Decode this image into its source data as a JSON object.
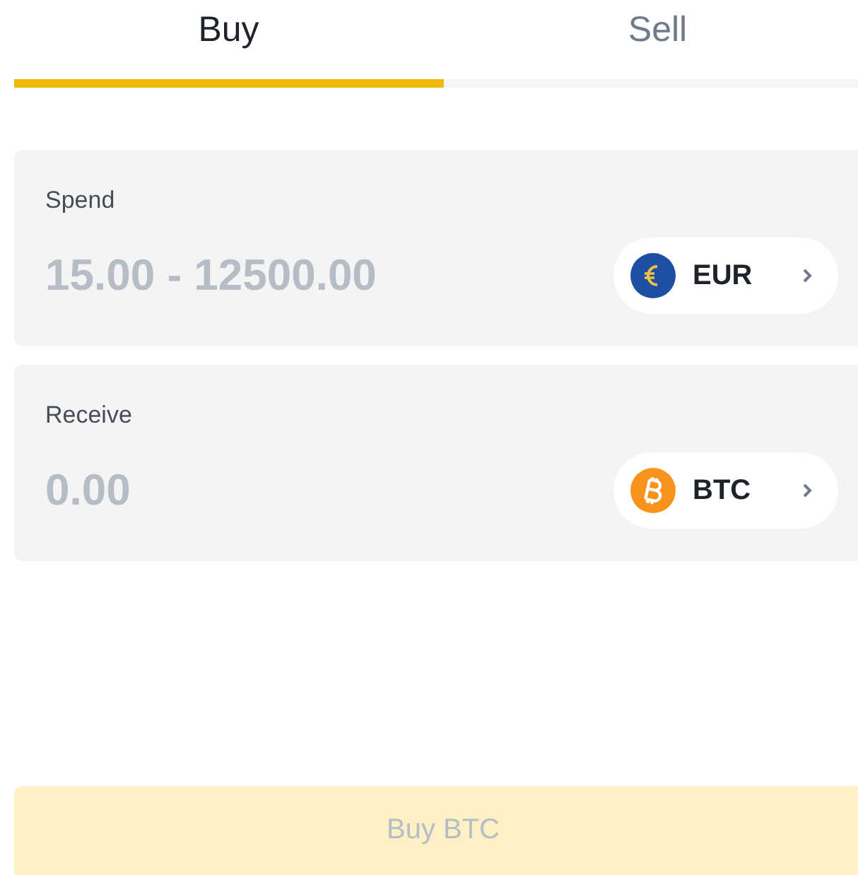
{
  "tabs": [
    {
      "label": "Buy",
      "selected": true
    },
    {
      "label": "Sell",
      "selected": false
    }
  ],
  "fields": [
    {
      "label": "Spend",
      "placeholder": "15.00 - 12500.00",
      "currency": "EUR",
      "color": "#1f4fa3"
    },
    {
      "label": "Receive",
      "placeholder": "0.00",
      "currency": "BTC",
      "color": "#f7931a"
    }
  ],
  "submit": {
    "label": "Buy BTC",
    "disabled": true
  }
}
